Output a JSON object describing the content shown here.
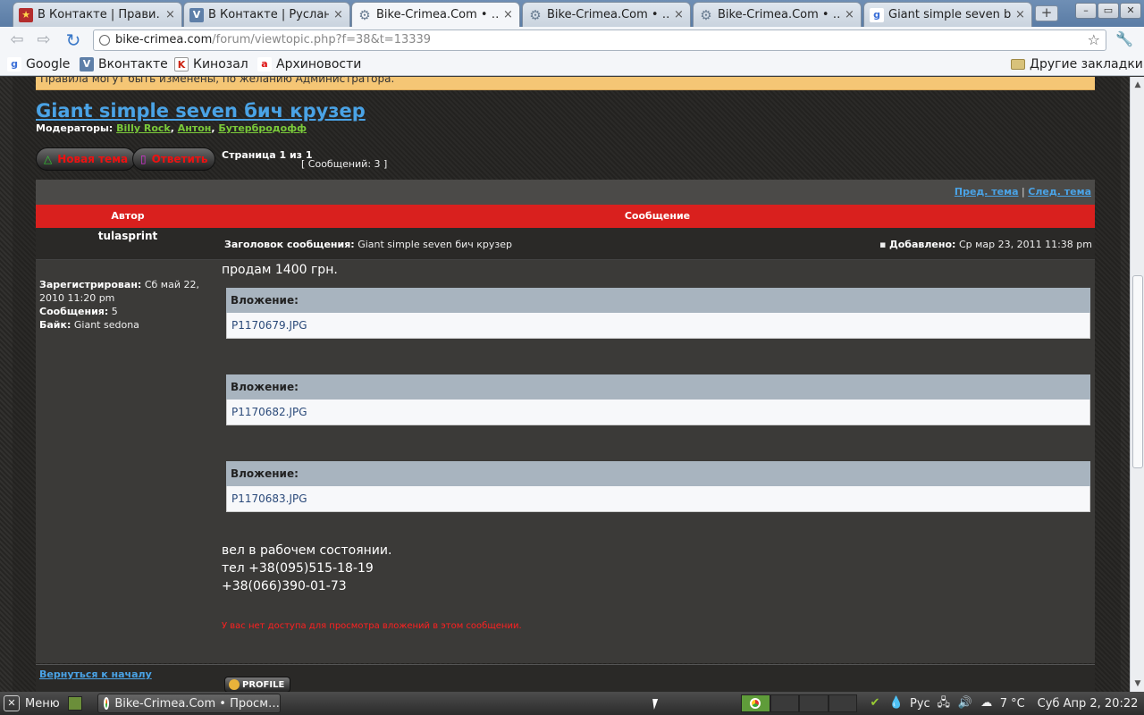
{
  "browser": {
    "tabs": [
      {
        "label": "В Контакте | Прави…",
        "icon": "star-icon",
        "active": false
      },
      {
        "label": "В Контакте | Руслан…",
        "icon": "vk-icon",
        "active": false
      },
      {
        "label": "Bike-Crimea.Com • …",
        "icon": "gear-icon",
        "active": true
      },
      {
        "label": "Bike-Crimea.Com • …",
        "icon": "gear-icon",
        "active": false
      },
      {
        "label": "Bike-Crimea.Com • …",
        "icon": "gear-icon",
        "active": false
      },
      {
        "label": "Giant simple seven b…",
        "icon": "google-icon",
        "active": false
      }
    ],
    "tab_close": "×",
    "new_tab": "+",
    "window_buttons": [
      "–",
      "▭",
      "✕"
    ],
    "url_host": "bike-crimea.com",
    "url_path": "/forum/viewtopic.php?f=38&t=13339",
    "bookmarks": [
      {
        "label": "Google",
        "icon": "g"
      },
      {
        "label": "Вконтакте",
        "icon": "V"
      },
      {
        "label": "Кинозал",
        "icon": "K"
      },
      {
        "label": "Архиновости",
        "icon": "a"
      }
    ],
    "other_bookmarks": "Другие закладки"
  },
  "forum": {
    "rules_text": "Правила могут быть изменены, по желанию Администратора.",
    "topic_title": "Giant simple seven бич крузер",
    "moderators_label": "Модераторы:",
    "moderators": [
      "Billy Rock",
      "Антон",
      "Бутербродофф"
    ],
    "new_topic_label": "Новая тема",
    "reply_label": "Ответить",
    "page_info": "Страница 1 из 1",
    "post_count": "[ Сообщений: 3 ]",
    "prev_topic": "Пред. тема",
    "separator": "|",
    "next_topic": "След. тема",
    "col_author": "Автор",
    "col_message": "Сообщение",
    "post": {
      "author": "tulasprint",
      "subject_label": "Заголовок сообщения:",
      "subject": "Giant simple seven бич крузер",
      "posted_label": "Добавлено:",
      "posted": "Ср мар 23, 2011 11:38 pm",
      "registered_label": "Зарегистрирован:",
      "registered": "Сб май 22, 2010 11:20 pm",
      "messages_label": "Сообщения:",
      "messages": "5",
      "bike_label": "Байк:",
      "bike": "Giant sedona",
      "text_intro": "продам 1400 грн.",
      "attachment_label": "Вложение:",
      "attachments": [
        "P1170679.JPG",
        "P1170682.JPG",
        "P1170683.JPG"
      ],
      "text_lines": [
        "вел в рабочем состоянии.",
        "тел +38(095)515-18-19",
        "+38(066)390-01-73"
      ],
      "no_access": "У вас нет доступа для просмотра вложений в этом сообщении."
    },
    "back_to_top": "Вернуться к началу",
    "profile_button": "PROFILE"
  },
  "taskbar": {
    "menu_label": "Меню",
    "task_label": "Bike-Crimea.Com • Просм…",
    "lang": "Рус",
    "temperature": "7 °C",
    "clock": "Суб Апр  2, 20:22"
  }
}
